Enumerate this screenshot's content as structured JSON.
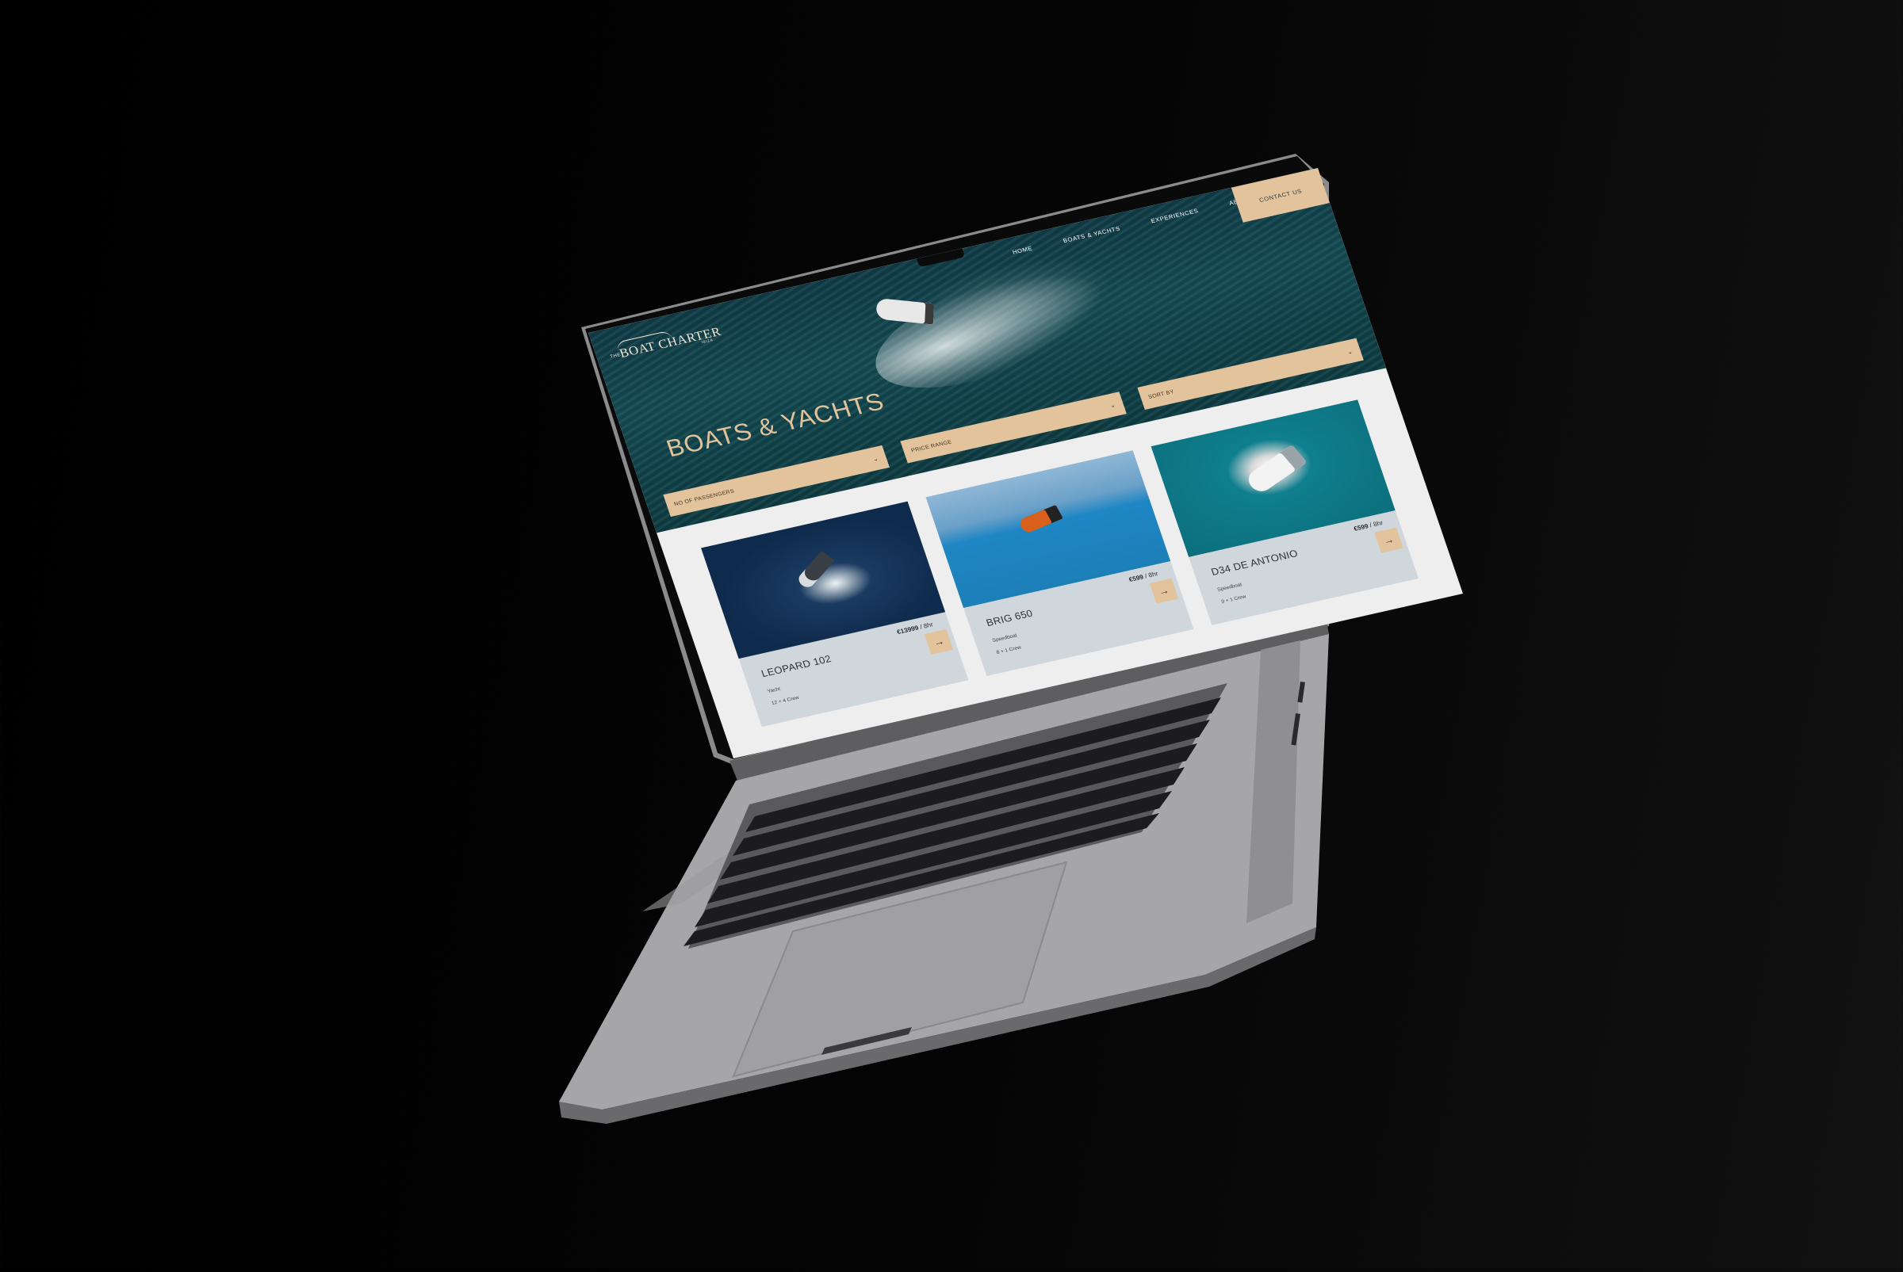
{
  "site": {
    "logo_the": "THE",
    "logo_main": "BOAT CHARTER",
    "logo_sub": "IBIZA",
    "nav": [
      "HOME",
      "BOATS & YACHTS",
      "EXPERIENCES",
      "ABOUT US"
    ],
    "contact_label": "CONTACT US",
    "page_title": "BOATS & YACHTS"
  },
  "filters": [
    {
      "label": "NO OF PASSENGERS",
      "icon": "chevron-down-icon"
    },
    {
      "label": "PRICE RANGE",
      "icon": "chevron-down-icon"
    },
    {
      "label": "SORT BY",
      "icon": "chevron-down-icon"
    }
  ],
  "cards": [
    {
      "name": "LEOPARD 102",
      "price": "€13999",
      "per": "/ 8hr",
      "type": "Yacht",
      "crew": "12 + 4 Crew",
      "arrow": "→"
    },
    {
      "name": "BRIG 650",
      "price": "€599",
      "per": "/ 8hr",
      "type": "Speedboat",
      "crew": "8 + 1 Crew",
      "arrow": "→"
    },
    {
      "name": "D34 DE ANTONIO",
      "price": "€599",
      "per": "/ 8hr",
      "type": "Speedboat",
      "crew": "9 + 1 Crew",
      "arrow": "→"
    }
  ],
  "colors": {
    "accent_sand": "#e3c39c",
    "hero_sea": "#134a52",
    "card_bg": "#cfd6dc",
    "laptop_silver": "#a9a9ab"
  }
}
